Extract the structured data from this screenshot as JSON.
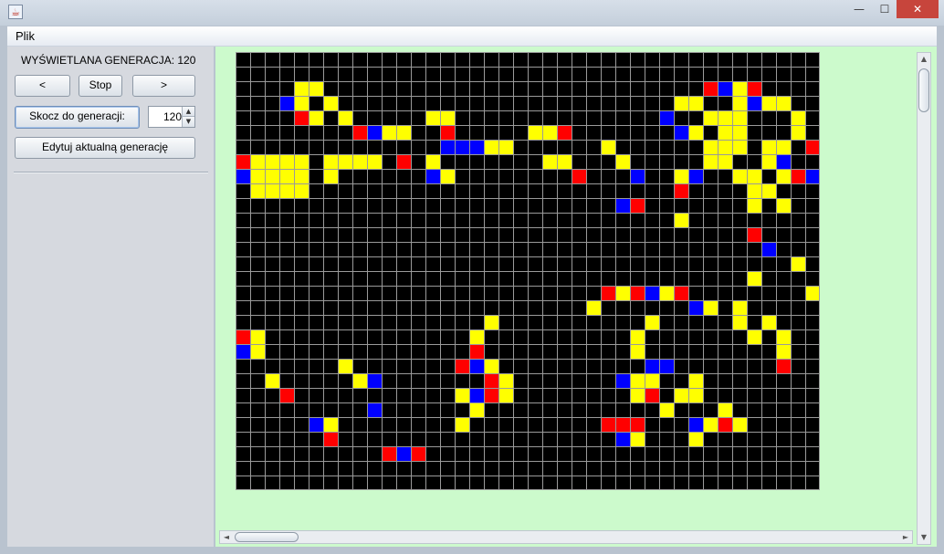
{
  "window": {
    "minimize": "—",
    "maximize": "☐",
    "close": "✕"
  },
  "menu": {
    "plik": "Plik"
  },
  "controls": {
    "generation_label": "WYŚWIETLANA GENERACJA: 120",
    "prev": "<",
    "stop": "Stop",
    "next": ">",
    "jump": "Skocz do generacji:",
    "jump_value": "120",
    "edit": "Edytuj aktualną generację"
  },
  "grid": {
    "cols": 40,
    "rows": 30,
    "colors": {
      "background": "#000000",
      "lines": "#9a9a9a",
      "Y": "#ffff00",
      "B": "#0000ff",
      "R": "#ff0000"
    },
    "cells": [
      "........................................",
      "........................................",
      "....YY..........................RBYR....",
      "...BY.Y.......................YY..YBYY..",
      "....RY.Y.....YY..............B..YYY...Y.",
      "........RBYY..R.....YYR.......BY.YY...Y.",
      "..............BBBYY......Y......YYY.YY.R",
      "RYYYY.YYYY.R.Y.......YY...Y.....YY..YB..",
      "BYYYY.Y......BY........R...B..YB..YY.YRB",
      ".YYYY.........................R....YY...",
      "..........................BR.......Y.Y..",
      "..............................Y..........",
      "...................................R....",
      "....................................B...",
      "......................................Y.",
      "...................................Y....",
      ".........................RYRBYR........Y",
      "........................Y......BY.Y.....",
      ".................Y..........Y.....Y.Y...",
      "RY..............Y..........Y.......Y.Y..",
      "BY..............R..........Y.........Y..",
      ".......Y.......RBY..........BB.......R..",
      "..Y.....YB.......RY.......BYY..Y........",
      "...R...........YBRY........YR.YY........",
      ".........B......Y............Y...Y......",
      ".....BY........Y.........RRR...BYRY.....",
      "......R...................BY...Y........",
      "..........RBR..........................."
    ]
  }
}
